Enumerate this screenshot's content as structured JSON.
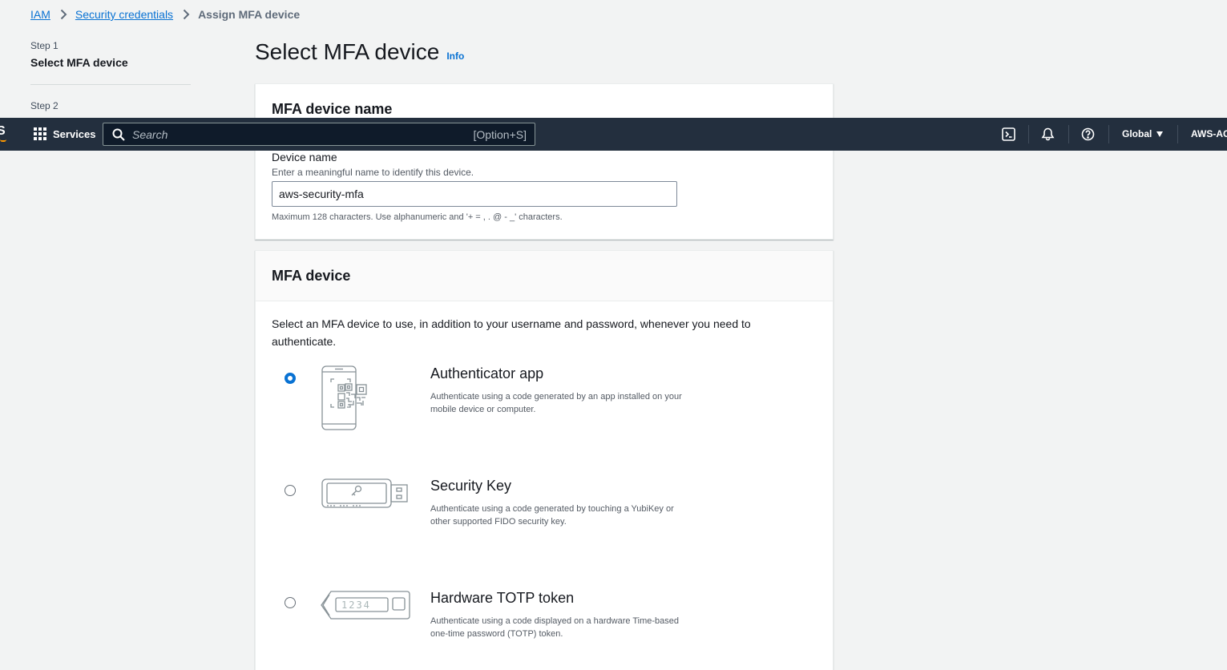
{
  "breadcrumb": {
    "items": [
      "IAM",
      "Security credentials"
    ],
    "current": "Assign MFA device"
  },
  "wizard": {
    "step1_label": "Step 1",
    "step1_title": "Select MFA device",
    "step2_label": "Step 2"
  },
  "main": {
    "title": "Select MFA device",
    "info_link": "Info"
  },
  "device_name_card": {
    "title": "MFA device name",
    "label": "Device name",
    "description": "Enter a meaningful name to identify this device.",
    "value": "aws-security-mfa",
    "constraint": "Maximum 128 characters. Use alphanumeric and '+ = , . @ - _' characters."
  },
  "mfa_card": {
    "title": "MFA device",
    "intro": "Select an MFA device to use, in addition to your username and password, whenever you need to authenticate.",
    "options": [
      {
        "title": "Authenticator app",
        "description": "Authenticate using a code generated by an app installed on your mobile device or computer.",
        "selected": true,
        "icon": "phone-qr-icon"
      },
      {
        "title": "Security Key",
        "description": "Authenticate using a code generated by touching a YubiKey or other supported FIDO security key.",
        "selected": false,
        "icon": "usb-key-icon"
      },
      {
        "title": "Hardware TOTP token",
        "description": "Authenticate using a code displayed on a hardware Time-based one-time password (TOTP) token.",
        "selected": false,
        "icon": "totp-token-icon",
        "token_digits": "1234"
      }
    ]
  },
  "topnav": {
    "logo_fragment": "S",
    "services_label": "Services",
    "search_placeholder": "Search",
    "search_shortcut": "[Option+S]",
    "region": "Global",
    "account": "AWS-AC",
    "icons": [
      "cloudshell-icon",
      "bell-icon",
      "help-icon"
    ]
  },
  "colors": {
    "link": "#0972d3",
    "nav_bg": "#232f3e",
    "page_bg": "#f2f3f3",
    "accent_orange": "#ff9900"
  }
}
